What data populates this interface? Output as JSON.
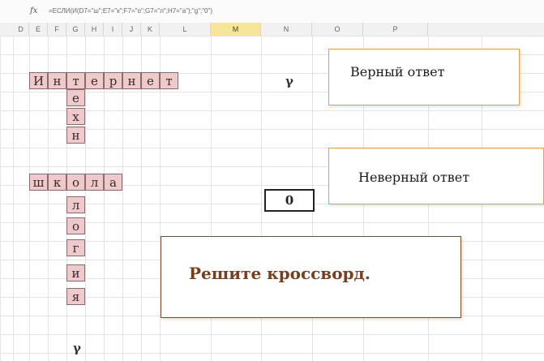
{
  "formula_bar": {
    "fx_label": "fx",
    "formula": "=ЕСЛИ(И(D7=\"ш\";E7=\"к\";F7=\"о\";G7=\"л\";H7=\"а\");\"g\";\"0\")"
  },
  "columns": [
    "D",
    "E",
    "F",
    "G",
    "H",
    "I",
    "J",
    "K",
    "L",
    "M",
    "N",
    "O",
    "P"
  ],
  "selected_column": "M",
  "crossword": {
    "word_internet": [
      "И",
      "н",
      "т",
      "е",
      "р",
      "н",
      "е",
      "т"
    ],
    "word_shkola": [
      "ш",
      "к",
      "о",
      "л",
      "а"
    ],
    "word_tehnologiya": [
      "т",
      "е",
      "х",
      "н",
      "о",
      "л",
      "о",
      "г",
      "и",
      "я"
    ]
  },
  "marks": {
    "internet_result": "γ",
    "tehnologiya_result": "γ"
  },
  "result_cell_value": "0",
  "callouts": {
    "correct": "Верный ответ",
    "wrong": "Неверный ответ",
    "task": "Решите кроссворд."
  },
  "colors": {
    "crossword_fill": "#eecacc",
    "selected_header": "#f7e59a",
    "callout_border": "#e0a04c",
    "task_text": "#7a3e1c"
  }
}
